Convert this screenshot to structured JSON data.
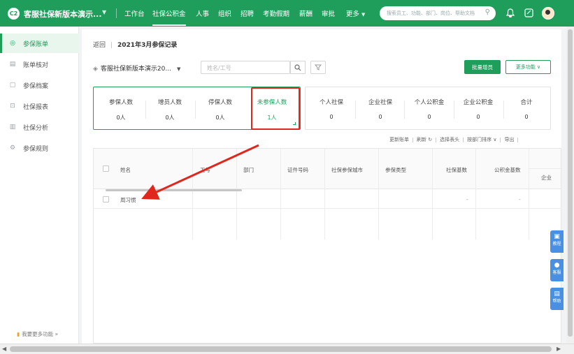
{
  "topbar": {
    "logo_text": "C2",
    "company": "客服社保新版本演示...",
    "nav": [
      "工作台",
      "社保公积金",
      "人事",
      "组织",
      "招聘",
      "考勤假期",
      "薪酬",
      "审批",
      "更多"
    ],
    "active_nav": "社保公积金",
    "search_placeholder": "搜索员工、功能、部门、岗位、帮助文档"
  },
  "sidebar": {
    "items": [
      {
        "icon": "gauge-icon",
        "label": "参保账单"
      },
      {
        "icon": "ledger-icon",
        "label": "账单核对"
      },
      {
        "icon": "file-icon",
        "label": "参保档案"
      },
      {
        "icon": "report-icon",
        "label": "社保报表"
      },
      {
        "icon": "chart-icon",
        "label": "社保分析"
      },
      {
        "icon": "rules-icon",
        "label": "参保规则"
      }
    ],
    "more": "我要更多功能"
  },
  "main": {
    "back": "返回",
    "title": "2021年3月参保记录",
    "company_select": "客服社保新版本演示20...",
    "name_placeholder": "姓名/工号",
    "batch_add": "批量增员",
    "more_func": "更多功能",
    "stats_left": [
      {
        "label": "参保人数",
        "value": "0人"
      },
      {
        "label": "增员人数",
        "value": "0人"
      },
      {
        "label": "停保人数",
        "value": "0人"
      },
      {
        "label": "未参保人数",
        "value": "1人"
      }
    ],
    "stats_right": [
      {
        "label": "个人社保",
        "value": "0"
      },
      {
        "label": "企业社保",
        "value": "0"
      },
      {
        "label": "个人公积金",
        "value": "0"
      },
      {
        "label": "企业公积金",
        "value": "0"
      },
      {
        "label": "合计",
        "value": "0"
      }
    ],
    "tools": [
      "更新账单",
      "刷新",
      "选择表头",
      "按部门排序",
      "导出"
    ],
    "columns": [
      "姓名",
      "工号",
      "部门",
      "证件号码",
      "社保参保城市",
      "参保类型",
      "社保基数",
      "公积金基数",
      "企业"
    ],
    "row": {
      "name": "周习惯",
      "social_base": "-",
      "fund_base": "-"
    }
  },
  "float": [
    {
      "icon": "book-icon",
      "label": "教程"
    },
    {
      "icon": "chat-icon",
      "label": "客服"
    },
    {
      "icon": "doc-icon",
      "label": "帮助"
    }
  ],
  "colors": {
    "brand": "#1e9e5a",
    "highlight_box": "#e0271d",
    "help_tab": "#4a90e2"
  }
}
